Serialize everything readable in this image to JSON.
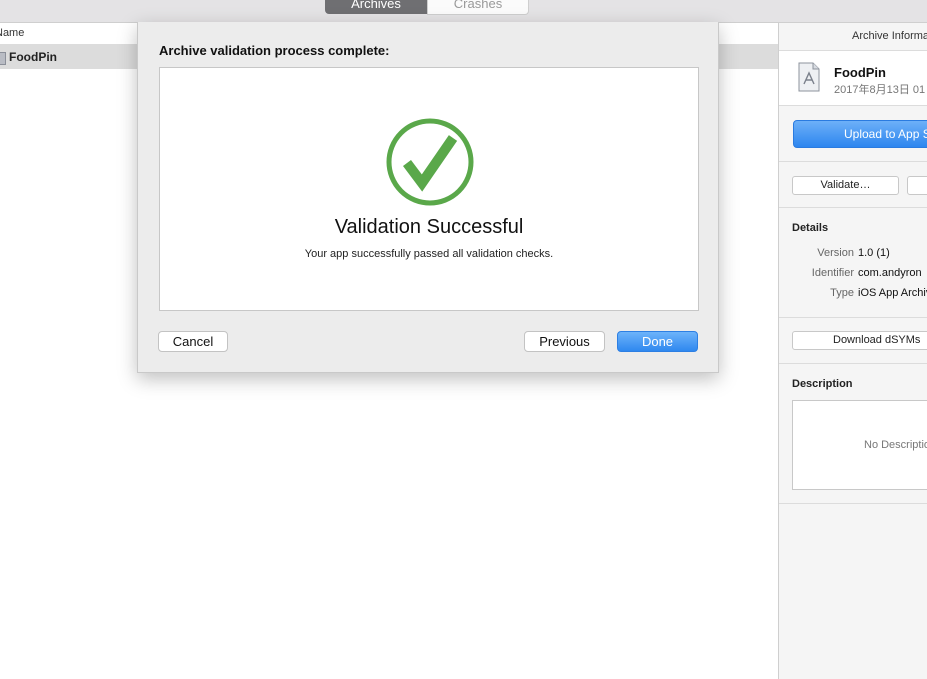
{
  "tabs": {
    "archives": "Archives",
    "crashes": "Crashes"
  },
  "list": {
    "column_header": "Name",
    "rows": [
      {
        "name": "FoodPin"
      }
    ]
  },
  "inspector": {
    "title": "Archive Information",
    "archive": {
      "name": "FoodPin",
      "date": "2017年8月13日 01"
    },
    "upload_label": "Upload to App Store",
    "validate_label": "Validate…",
    "details_title": "Details",
    "details": [
      {
        "label": "Version",
        "value": "1.0 (1)"
      },
      {
        "label": "Identifier",
        "value": "com.andyron"
      },
      {
        "label": "Type",
        "value": "iOS App Archive"
      }
    ],
    "download_label": "Download dSYMs",
    "description_title": "Description",
    "description_placeholder": "No Description"
  },
  "sheet": {
    "title": "Archive validation process complete:",
    "result_title": "Validation Successful",
    "result_text": "Your app successfully passed all validation checks.",
    "cancel_label": "Cancel",
    "previous_label": "Previous",
    "done_label": "Done"
  },
  "colors": {
    "success_green": "#5aa84a",
    "accent_blue": "#2f88ef"
  }
}
